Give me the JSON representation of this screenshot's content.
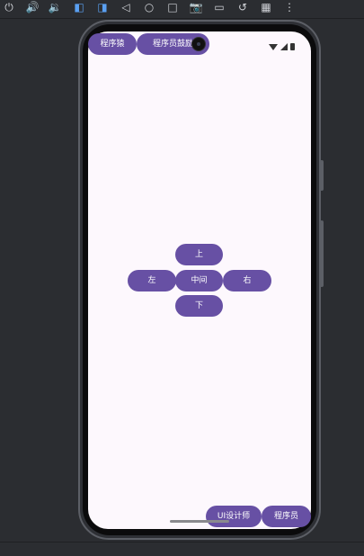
{
  "toolbar": {
    "icons": [
      "power-icon",
      "volume-up-icon",
      "volume-down-icon",
      "rotate-left-icon",
      "rotate-right-icon",
      "back-icon",
      "home-icon",
      "overview-icon",
      "screenshot-icon",
      "record-icon",
      "rewind-icon",
      "snapshot-icon",
      "more-icon"
    ]
  },
  "app": {
    "top_left_button": "程序猿",
    "top_button": "程序员鼓励",
    "up_button": "上",
    "left_button": "左",
    "center_button": "中间",
    "right_button": "右",
    "down_button": "下",
    "bottom_left_button": "UI设计师",
    "bottom_right_button": "程序员"
  },
  "colors": {
    "accent": "#6750a4",
    "screen_bg": "#fdf8fd",
    "ide_bg": "#2b2d31",
    "active_icon": "#5aa0f2"
  }
}
